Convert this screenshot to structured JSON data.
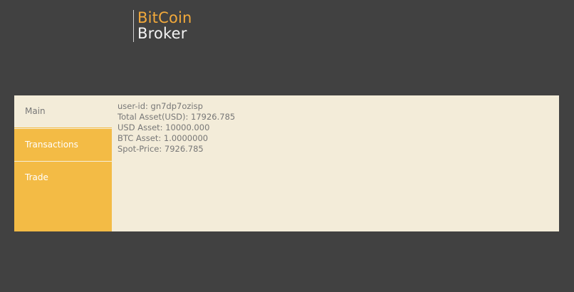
{
  "logo": {
    "line1": "BitCoin",
    "line2": "Broker"
  },
  "colors": {
    "background": "#414141",
    "accent": "#f2a93b",
    "sidebar": "#f3bb45",
    "panel": "#f3ecd9",
    "text_muted": "#777777"
  },
  "nav": {
    "items": [
      {
        "label": "Main",
        "active": true
      },
      {
        "label": "Transactions",
        "active": false
      },
      {
        "label": "Trade",
        "active": false
      }
    ]
  },
  "account": {
    "user_id": "user-id: gn7dp7ozisp",
    "total_asset": "Total Asset(USD): 17926.785",
    "usd_asset": "USD Asset: 10000.000",
    "btc_asset": "BTC Asset: 1.0000000",
    "spot_price": "Spot-Price: 7926.785"
  }
}
